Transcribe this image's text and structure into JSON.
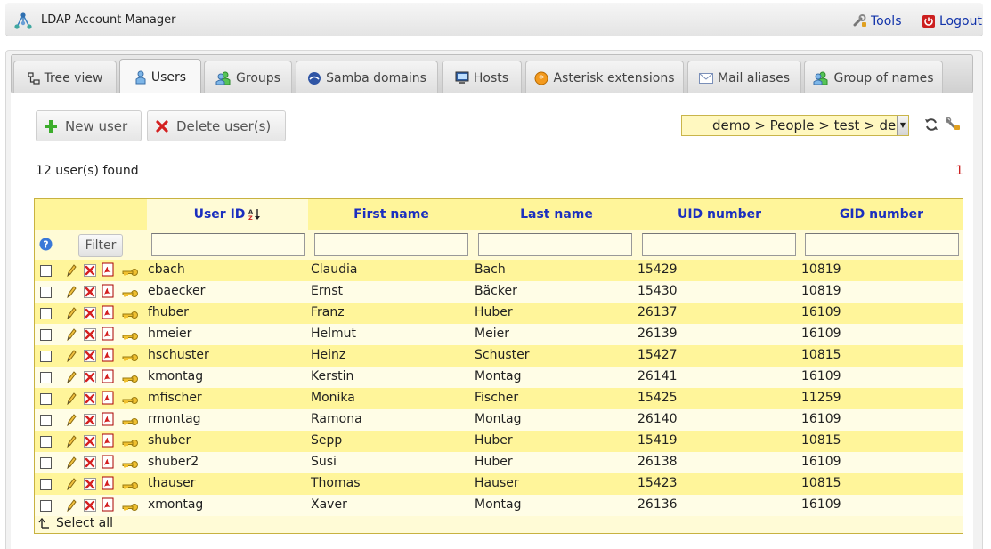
{
  "header": {
    "app_title": "LDAP Account Manager",
    "tools_label": "Tools",
    "logout_label": "Logout"
  },
  "tabs": [
    {
      "label": "Tree view",
      "icon": "tree-icon"
    },
    {
      "label": "Users",
      "icon": "user-icon",
      "active": true
    },
    {
      "label": "Groups",
      "icon": "groups-icon"
    },
    {
      "label": "Samba domains",
      "icon": "samba-icon"
    },
    {
      "label": "Hosts",
      "icon": "host-icon"
    },
    {
      "label": "Asterisk extensions",
      "icon": "asterisk-icon"
    },
    {
      "label": "Mail aliases",
      "icon": "mail-icon"
    },
    {
      "label": "Group of names",
      "icon": "group-of-names-icon"
    }
  ],
  "toolbar": {
    "new_label": "New user",
    "delete_label": "Delete user(s)",
    "suffix_value": "demo > People > test > de"
  },
  "list": {
    "found_text": "12 user(s) found",
    "page": "1",
    "filter_label": "Filter",
    "select_all_label": "Select all",
    "columns": [
      "User ID",
      "First name",
      "Last name",
      "UID number",
      "GID number"
    ],
    "sort_indicator": "A↓Z",
    "rows": [
      {
        "uid": "cbach",
        "first": "Claudia",
        "last": "Bach",
        "uidnum": "15429",
        "gidnum": "10819"
      },
      {
        "uid": "ebaecker",
        "first": "Ernst",
        "last": "Bäcker",
        "uidnum": "15430",
        "gidnum": "10819"
      },
      {
        "uid": "fhuber",
        "first": "Franz",
        "last": "Huber",
        "uidnum": "26137",
        "gidnum": "16109"
      },
      {
        "uid": "hmeier",
        "first": "Helmut",
        "last": "Meier",
        "uidnum": "26139",
        "gidnum": "16109"
      },
      {
        "uid": "hschuster",
        "first": "Heinz",
        "last": "Schuster",
        "uidnum": "15427",
        "gidnum": "10815"
      },
      {
        "uid": "kmontag",
        "first": "Kerstin",
        "last": "Montag",
        "uidnum": "26141",
        "gidnum": "16109"
      },
      {
        "uid": "mfischer",
        "first": "Monika",
        "last": "Fischer",
        "uidnum": "15425",
        "gidnum": "11259"
      },
      {
        "uid": "rmontag",
        "first": "Ramona",
        "last": "Montag",
        "uidnum": "26140",
        "gidnum": "16109"
      },
      {
        "uid": "shuber",
        "first": "Sepp",
        "last": "Huber",
        "uidnum": "15419",
        "gidnum": "10815"
      },
      {
        "uid": "shuber2",
        "first": "Susi",
        "last": "Huber",
        "uidnum": "26138",
        "gidnum": "16109"
      },
      {
        "uid": "thauser",
        "first": "Thomas",
        "last": "Hauser",
        "uidnum": "15423",
        "gidnum": "10815"
      },
      {
        "uid": "xmontag",
        "first": "Xaver",
        "last": "Montag",
        "uidnum": "26136",
        "gidnum": "16109"
      }
    ]
  },
  "colors": {
    "header_fill": "#fff59a",
    "row_alt": "#fffde6",
    "link_blue": "#1b2fbf",
    "page_red": "#cc2222"
  }
}
